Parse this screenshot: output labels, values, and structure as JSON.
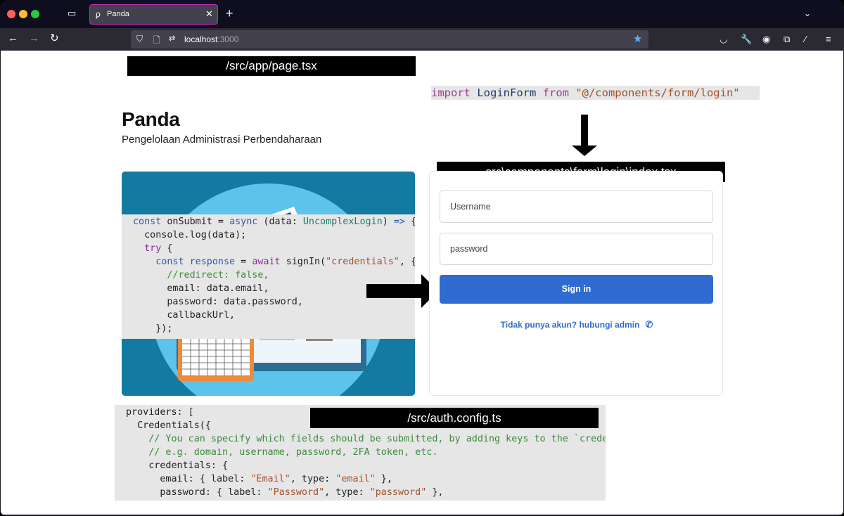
{
  "browser": {
    "tab_title": "Panda",
    "url_host": "localhost",
    "url_port": ":3000",
    "icons": [
      "tab-overview-icon",
      "close-icon",
      "plus-icon",
      "chevron-down-icon",
      "back-arrow-icon",
      "forward-arrow-icon",
      "reload-icon",
      "shield-icon",
      "page-icon",
      "permissions-icon",
      "star-icon",
      "pocket-icon",
      "wrench-icon",
      "account-icon",
      "extensions-icon",
      "brush-icon",
      "menu-icon"
    ],
    "colors": {
      "tab_border": "#c22ab8",
      "star": "#54b6f1"
    }
  },
  "annotations": {
    "page_label": "/src/app/page.tsx",
    "index_label": "src\\components\\form\\login\\index.tsx",
    "auth_label": "/src/auth.config.ts",
    "import_kw": "import",
    "import_name": " LoginForm ",
    "import_from": "from",
    "import_path": " \"@/components/form/login\""
  },
  "page": {
    "title": "Panda",
    "subtitle": "Pengelolaan Administrasi Perbendaharaan"
  },
  "login": {
    "username_placeholder": "Username",
    "password_placeholder": "password",
    "signin_label": "Sign in",
    "contact_text": "Tidak punya akun? hubungi admin",
    "accent_color": "#2f6bd0"
  },
  "onsubmit_code": [
    [
      [
        "const ",
        "c-blue"
      ],
      [
        "onSubmit",
        "c-dark"
      ],
      [
        " = ",
        "c-dark"
      ],
      [
        "async",
        "c-blue"
      ],
      [
        " (data: ",
        "c-dark"
      ],
      [
        "UncomplexLogin",
        "c-type"
      ],
      [
        ") ",
        "c-dark"
      ],
      [
        "=>",
        "c-blue"
      ],
      [
        " {",
        "c-dark"
      ]
    ],
    [
      [
        "  console.log(data);",
        "c-dark"
      ]
    ],
    [
      [
        "  ",
        "c-dark"
      ],
      [
        "try",
        "c-purple"
      ],
      [
        " {",
        "c-dark"
      ]
    ],
    [
      [
        "    ",
        "c-dark"
      ],
      [
        "const ",
        "c-blue"
      ],
      [
        "response",
        "c-blue"
      ],
      [
        " = ",
        "c-dark"
      ],
      [
        "await ",
        "c-purple"
      ],
      [
        "signIn(",
        "c-dark"
      ],
      [
        "\"credentials\"",
        "c-str"
      ],
      [
        ", {",
        "c-dark"
      ]
    ],
    [
      [
        "      //redirect: false,",
        "c-comment"
      ]
    ],
    [
      [
        "      email: data.email,",
        "c-dark"
      ]
    ],
    [
      [
        "      password: data.password,",
        "c-dark"
      ]
    ],
    [
      [
        "      callbackUrl,",
        "c-dark"
      ]
    ],
    [
      [
        "    });",
        "c-dark"
      ]
    ]
  ],
  "auth_code": [
    [
      [
        "providers: [",
        "c-dark"
      ]
    ],
    [
      [
        "  Credentials({",
        "c-dark"
      ]
    ],
    [
      [
        "    // You can specify which fields should be submitted, by adding keys to the `credentials`",
        "c-comment"
      ]
    ],
    [
      [
        "    // e.g. domain, username, password, 2FA token, etc.",
        "c-comment"
      ]
    ],
    [
      [
        "    credentials: {",
        "c-dark"
      ]
    ],
    [
      [
        "      email: { label: ",
        "c-dark"
      ],
      [
        "\"Email\"",
        "c-str"
      ],
      [
        ", type: ",
        "c-dark"
      ],
      [
        "\"email\"",
        "c-str"
      ],
      [
        " },",
        "c-dark"
      ]
    ],
    [
      [
        "      password: { label: ",
        "c-dark"
      ],
      [
        "\"Password\"",
        "c-str"
      ],
      [
        ", type: ",
        "c-dark"
      ],
      [
        "\"password\"",
        "c-str"
      ],
      [
        " },",
        "c-dark"
      ]
    ]
  ]
}
